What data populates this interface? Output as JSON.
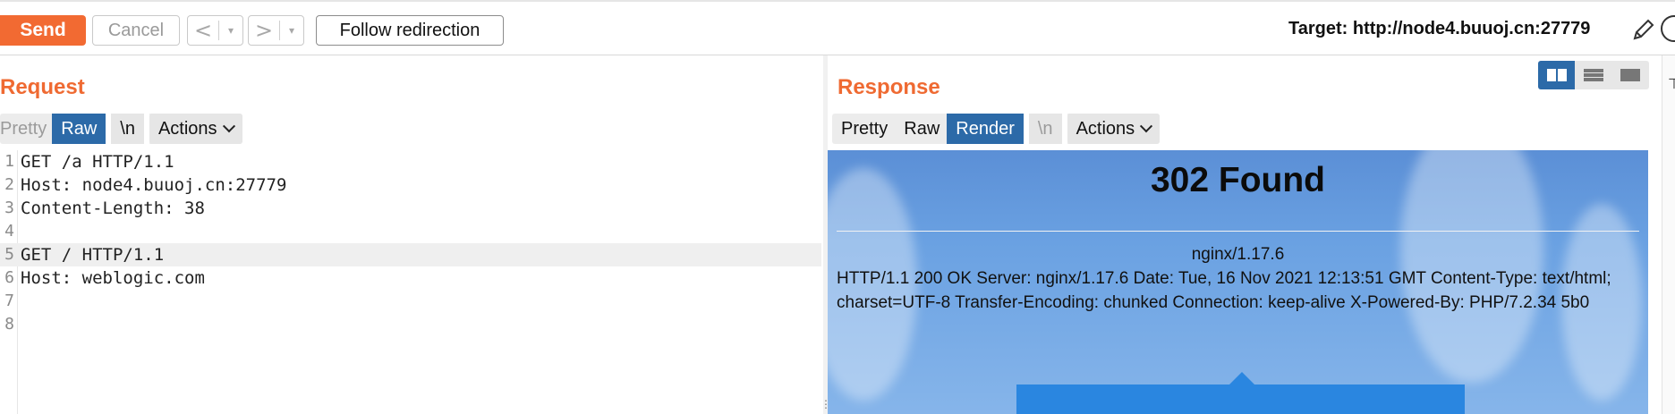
{
  "toolbar": {
    "send_label": "Send",
    "cancel_label": "Cancel",
    "back_label": "<",
    "forward_label": ">",
    "dropdown_glyph": "▾",
    "follow_label": "Follow redirection",
    "target_text": "Target: http://node4.buuoj.cn:27779",
    "edit_icon": "pencil-icon",
    "help_icon": "help-circle-icon"
  },
  "request": {
    "title": "Request",
    "tabs": [
      {
        "label": "Pretty",
        "state": "disabled"
      },
      {
        "label": "Raw",
        "state": "active"
      },
      {
        "label": "\\n",
        "state": "normal"
      }
    ],
    "actions_label": "Actions",
    "lines": [
      {
        "n": "1",
        "text": "GET /a HTTP/1.1"
      },
      {
        "n": "2",
        "text": "Host: node4.buuoj.cn:27779"
      },
      {
        "n": "3",
        "text": "Content-Length: 38"
      },
      {
        "n": "4",
        "text": ""
      },
      {
        "n": "5",
        "text": "GET / HTTP/1.1"
      },
      {
        "n": "6",
        "text": "Host: weblogic.com"
      },
      {
        "n": "7",
        "text": ""
      },
      {
        "n": "8",
        "text": ""
      }
    ]
  },
  "response": {
    "title": "Response",
    "tabs": [
      {
        "label": "Pretty",
        "state": "normal"
      },
      {
        "label": "Raw",
        "state": "normal"
      },
      {
        "label": "Render",
        "state": "active"
      },
      {
        "label": "\\n",
        "state": "disabled"
      }
    ],
    "actions_label": "Actions",
    "view_modes": [
      "split-columns-icon",
      "split-rows-icon",
      "single-view-icon"
    ],
    "render": {
      "heading": "302 Found",
      "server": "nginx/1.17.6",
      "body": "HTTP/1.1 200 OK Server: nginx/1.17.6 Date: Tue, 16 Nov 2021 12:13:51 GMT Content-Type: text/html; charset=UTF-8 Transfer-Encoding: chunked Connection: keep-alive X-Powered-By: PHP/7.2.34 5b0"
    }
  },
  "colors": {
    "accent": "#f26a32",
    "active_tab": "#2c6aa8",
    "render_bg": "#6aa1e2"
  }
}
